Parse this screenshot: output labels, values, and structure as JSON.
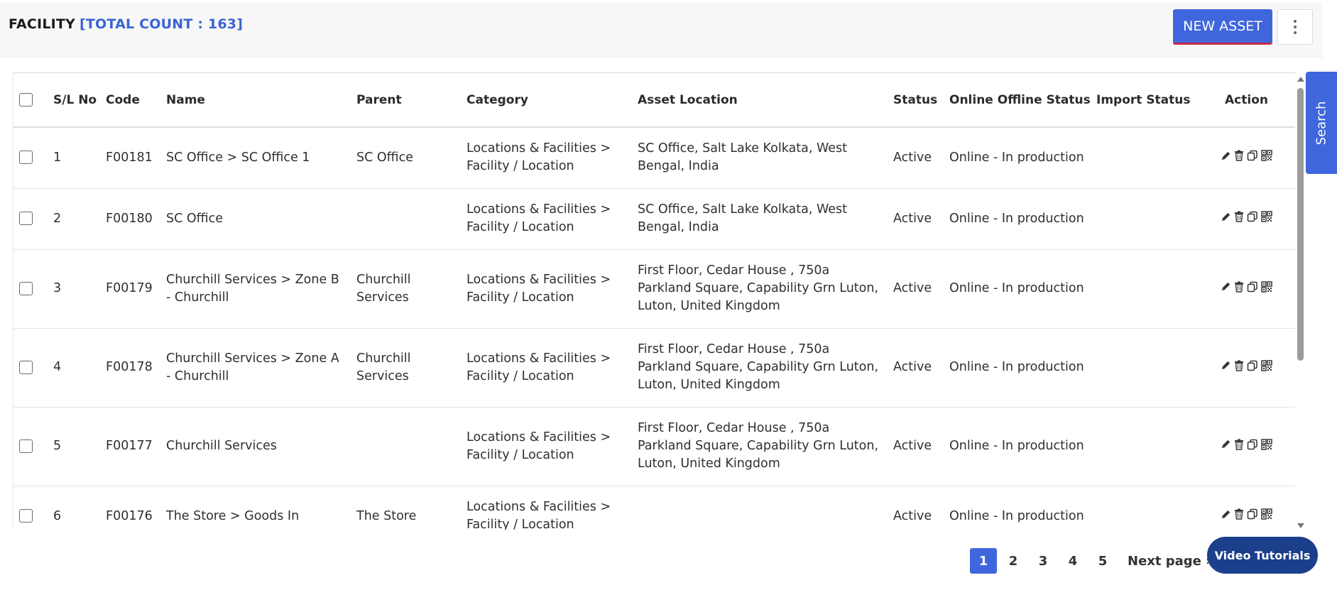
{
  "header": {
    "title": "FACILITY",
    "total_count": "[TOTAL COUNT : 163]",
    "new_asset_label": "NEW ASSET"
  },
  "table": {
    "columns": [
      "S/L No",
      "Code",
      "Name",
      "Parent",
      "Category",
      "Asset Location",
      "Status",
      "Online Offline Status",
      "Import Status",
      "Action"
    ],
    "rows": [
      {
        "sl": "1",
        "code": "F00181",
        "name": "SC Office > SC Office 1",
        "parent": "SC Office",
        "category": "Locations & Facilities > Facility / Location",
        "location": "SC Office, Salt Lake Kolkata, West Bengal, India",
        "status": "Active",
        "online": "Online - In production",
        "import": ""
      },
      {
        "sl": "2",
        "code": "F00180",
        "name": "SC Office",
        "parent": "",
        "category": "Locations & Facilities > Facility / Location",
        "location": "SC Office, Salt Lake Kolkata, West Bengal, India",
        "status": "Active",
        "online": "Online - In production",
        "import": ""
      },
      {
        "sl": "3",
        "code": "F00179",
        "name": "Churchill Services > Zone B - Churchill",
        "parent": "Churchill Services",
        "category": "Locations & Facilities > Facility / Location",
        "location": "First Floor, Cedar House , 750a Parkland Square, Capability Grn Luton, Luton, United Kingdom",
        "status": "Active",
        "online": "Online - In production",
        "import": ""
      },
      {
        "sl": "4",
        "code": "F00178",
        "name": "Churchill Services > Zone A - Churchill",
        "parent": "Churchill Services",
        "category": "Locations & Facilities > Facility / Location",
        "location": "First Floor, Cedar House , 750a Parkland Square, Capability Grn Luton, Luton, United Kingdom",
        "status": "Active",
        "online": "Online - In production",
        "import": ""
      },
      {
        "sl": "5",
        "code": "F00177",
        "name": "Churchill Services",
        "parent": "",
        "category": "Locations & Facilities > Facility / Location",
        "location": "First Floor, Cedar House , 750a Parkland Square, Capability Grn Luton, Luton, United Kingdom",
        "status": "Active",
        "online": "Online - In production",
        "import": ""
      },
      {
        "sl": "6",
        "code": "F00176",
        "name": "The Store > Goods In",
        "parent": "The Store",
        "category": "Locations & Facilities > Facility / Location",
        "location": "",
        "status": "Active",
        "online": "Online - In production",
        "import": ""
      }
    ],
    "action_icons": [
      "edit-icon",
      "delete-icon",
      "copy-icon",
      "qr-code-icon"
    ]
  },
  "sidebar_tab": {
    "search_label": "Search"
  },
  "pagination": {
    "pages": [
      "1",
      "2",
      "3",
      "4",
      "5"
    ],
    "active_page": "1",
    "next_label": "Next page »"
  },
  "help": {
    "video_tutorials_label": "Video Tutorials"
  },
  "colors": {
    "accent": "#3f66dc",
    "underline": "#c42a4a",
    "help_button": "#1c3f8c"
  }
}
